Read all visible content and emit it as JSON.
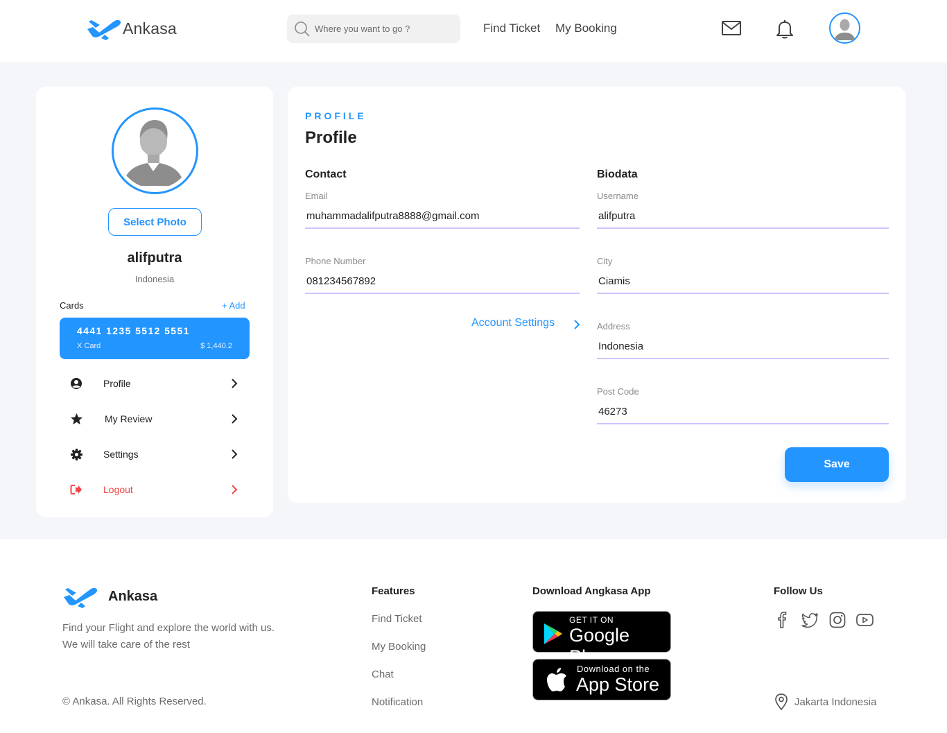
{
  "brand": {
    "name": "Ankasa",
    "accent": "#2395ff",
    "icon": "plane-icon"
  },
  "header": {
    "search_placeholder": "Where you want to go ?",
    "nav": [
      "Find Ticket",
      "My Booking"
    ],
    "icons": [
      "mail-icon",
      "bell-icon",
      "avatar"
    ]
  },
  "sidebar": {
    "select_photo": "Select Photo",
    "username": "alifputra",
    "country": "Indonesia",
    "cards_label": "Cards",
    "add_label": "+ Add",
    "card": {
      "number": "4441 1235 5512 5551",
      "type": "X Card",
      "balance": "$ 1,440.2"
    },
    "menu": [
      {
        "label": "Profile",
        "icon": "user-circle-icon"
      },
      {
        "label": "My Review",
        "icon": "star-icon"
      },
      {
        "label": "Settings",
        "icon": "gear-icon"
      },
      {
        "label": "Logout",
        "icon": "logout-icon",
        "color": "#f24545"
      }
    ]
  },
  "profile": {
    "kicker": "PROFILE",
    "title": "Profile",
    "contact": {
      "title": "Contact",
      "email_label": "Email",
      "email": "muhammadalifputra8888@gmail.com",
      "phone_label": "Phone Number",
      "phone": "081234567892",
      "account_settings": "Account Settings"
    },
    "biodata": {
      "title": "Biodata",
      "username_label": "Username",
      "username": "alifputra",
      "city_label": "City",
      "city": "Ciamis",
      "address_label": "Address",
      "address": "Indonesia",
      "postcode_label": "Post Code",
      "postcode": "46273"
    },
    "save": "Save"
  },
  "footer": {
    "brand": "Ankasa",
    "tagline": "Find your Flight and explore the world with us. We will take care of the rest",
    "copyright": "© Ankasa. All Rights Reserved.",
    "features_title": "Features",
    "features": [
      "Find Ticket",
      "My Booking",
      "Chat",
      "Notification"
    ],
    "download_title": "Download Angkasa App",
    "google_play": {
      "small": "GET IT ON",
      "big": "Google Play"
    },
    "app_store": {
      "small": "Download on the",
      "big": "App Store"
    },
    "follow_title": "Follow Us",
    "social": [
      "facebook-icon",
      "twitter-icon",
      "instagram-icon",
      "youtube-icon"
    ],
    "location": "Jakarta Indonesia"
  }
}
